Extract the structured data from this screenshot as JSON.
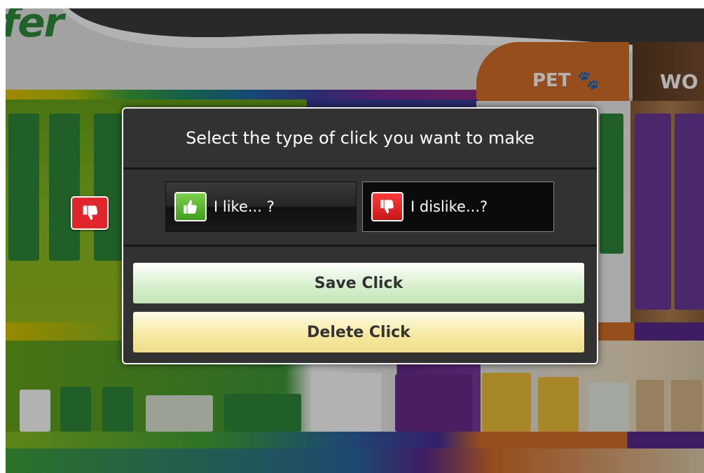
{
  "background": {
    "brand_logo": "fer",
    "aisle_signs": [
      "PET",
      "WO"
    ],
    "pet_icon": "paw-icon",
    "existing_marker": {
      "icon": "thumbs-down-icon",
      "color": "#e0262a"
    }
  },
  "dialog": {
    "title": "Select the type of click you want to make",
    "like_label": "I like... ?",
    "like_icon": "thumbs-up-icon",
    "dislike_label": "I dislike...?",
    "dislike_icon": "thumbs-down-icon",
    "save_label": "Save Click",
    "delete_label": "Delete Click"
  },
  "colors": {
    "like_green": "#5bb531",
    "dislike_red": "#e0262a",
    "save_green": "#c3e6b6",
    "delete_yellow": "#efdc84",
    "modal_bg": "#323232"
  }
}
